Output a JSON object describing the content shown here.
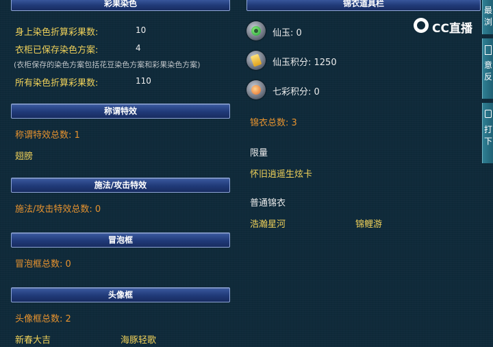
{
  "left": {
    "dye": {
      "title": "彩果染色",
      "rows": [
        {
          "label": "身上染色折算彩果数:",
          "value": "10"
        },
        {
          "label": "衣柜已保存染色方案:",
          "value": "4"
        },
        {
          "label": "所有染色折算彩果数:",
          "value": "110"
        }
      ],
      "note": "(衣柜保存的染色方案包括花豆染色方案和彩果染色方案)"
    },
    "title_effects": {
      "title": "称谓特效",
      "total": "称谓特效总数: 1",
      "items": [
        "翅膀"
      ]
    },
    "cast_effects": {
      "title": "施法/攻击特效",
      "total": "施法/攻击特效总数: 0"
    },
    "bubble": {
      "title": "冒泡框",
      "total": "冒泡框总数: 0"
    },
    "avatar": {
      "title": "头像框",
      "total": "头像框总数: 2",
      "items": [
        "新春大吉",
        "海豚轻歌"
      ]
    }
  },
  "right": {
    "title": "锦衣道具栏",
    "currencies": [
      {
        "icon": "jade-icon",
        "label": "仙玉: 0"
      },
      {
        "icon": "jade-points-icon",
        "label": "仙玉积分: 1250"
      },
      {
        "icon": "rainbow-points-icon",
        "label": "七彩积分: 0"
      }
    ],
    "total": "锦衣总数: 3",
    "limited": {
      "header": "限量",
      "items": [
        "怀旧逍遥生炫卡"
      ]
    },
    "normal": {
      "header": "普通锦衣",
      "items": [
        "浩瀚星河",
        "锦鲤游"
      ]
    }
  },
  "overlay": {
    "logo": "CC直播"
  },
  "side_tabs": [
    "最",
    "浏",
    "意",
    "反",
    "打",
    "下"
  ]
}
